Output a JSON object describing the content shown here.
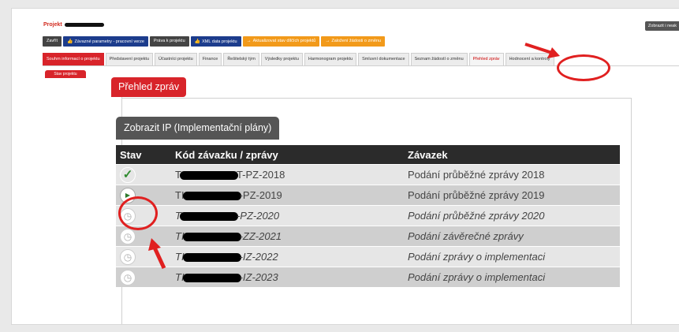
{
  "project": {
    "title": "Projekt"
  },
  "header_right_button": "Zobrazit i neak",
  "toolbar": [
    {
      "label": "Zavřít",
      "style": "dark",
      "icon": ""
    },
    {
      "label": "Závazné parametry - pracovní verze",
      "style": "blue",
      "icon": "thumb-up-icon"
    },
    {
      "label": "Práva k projektu",
      "style": "dark",
      "icon": ""
    },
    {
      "label": "XML data projektu",
      "style": "blue",
      "icon": "thumb-up-icon"
    },
    {
      "label": "Aktualizovat stav dílčích projektů",
      "style": "orange",
      "icon": "arrow-right-icon"
    },
    {
      "label": "Založení žádosti o změnu",
      "style": "orange",
      "icon": "arrow-right-icon"
    }
  ],
  "tabs": [
    {
      "label": "Souhrn informací o projektu",
      "state": "active"
    },
    {
      "label": "Představení projektu",
      "state": ""
    },
    {
      "label": "Účastníci projektu",
      "state": ""
    },
    {
      "label": "Finance",
      "state": ""
    },
    {
      "label": "Řešitelský tým",
      "state": ""
    },
    {
      "label": "Výsledky projektu",
      "state": ""
    },
    {
      "label": "Harmonogram projektu",
      "state": ""
    },
    {
      "label": "Smluvní dokumentace",
      "state": ""
    },
    {
      "label": "Seznam žádostí o změnu",
      "state": ""
    },
    {
      "label": "Přehled zpráv",
      "state": "highlight"
    },
    {
      "label": "Hodnocení a kontroly",
      "state": ""
    }
  ],
  "subtab": "Stav projektu",
  "section_title": "Přehled zpráv",
  "ip_button": "Zobrazit IP (Implementační plány)",
  "table": {
    "headers": [
      "Stav",
      "Kód závazku / zprávy",
      "Závazek"
    ],
    "rows": [
      {
        "status": "done",
        "code_prefix": "T",
        "code_suffix": "T-PZ-2018",
        "duty": "Podání průběžné zprávy 2018",
        "italic": false
      },
      {
        "status": "play",
        "code_prefix": "TI",
        "code_suffix": "-PZ-2019",
        "duty": "Podání průběžné zprávy 2019",
        "italic": false
      },
      {
        "status": "clock",
        "code_prefix": "T",
        "code_suffix": "-PZ-2020",
        "duty": "Podání průběžné zprávy 2020",
        "italic": true
      },
      {
        "status": "clock",
        "code_prefix": "TI",
        "code_suffix": "-ZZ-2021",
        "duty": "Podání závěrečné zprávy",
        "italic": true
      },
      {
        "status": "clock",
        "code_prefix": "TI",
        "code_suffix": "-IZ-2022",
        "duty": "Podání zprávy o implementaci",
        "italic": true
      },
      {
        "status": "clock",
        "code_prefix": "TI",
        "code_suffix": "-IZ-2023",
        "duty": "Podání zprávy o implementaci",
        "italic": true
      }
    ]
  },
  "colors": {
    "accent_red": "#d8242a",
    "toolbar_blue": "#1c3c8c",
    "toolbar_orange": "#f29a1a",
    "header_dark": "#2b2b2b"
  },
  "status_icons": {
    "done": "check-icon",
    "play": "play-icon",
    "clock": "clock-icon"
  }
}
